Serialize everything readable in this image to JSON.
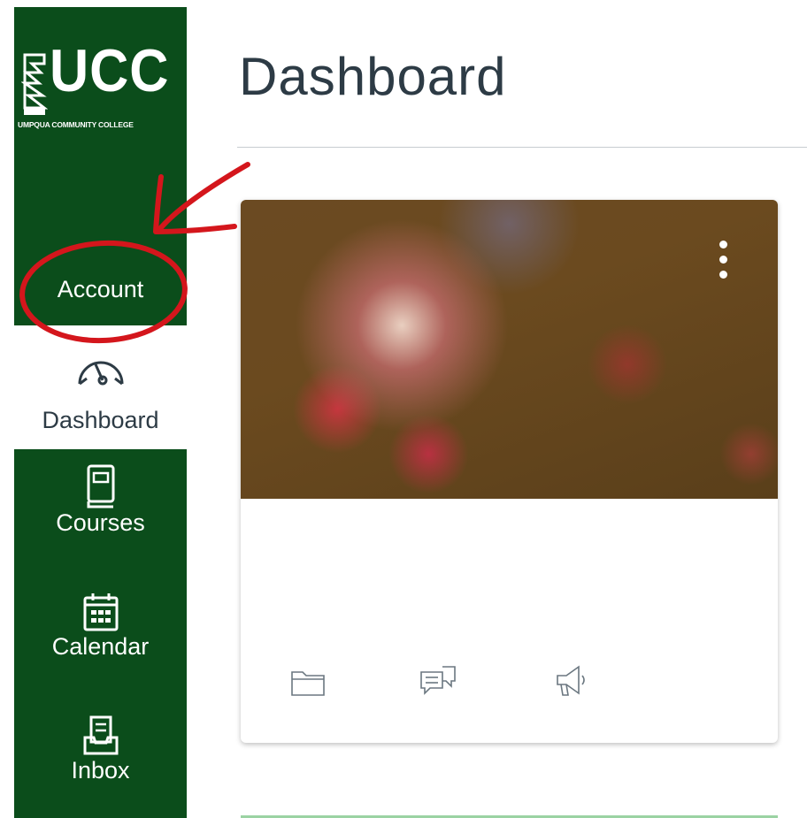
{
  "sidebar": {
    "logo": {
      "text": "UCC",
      "subtitle": "UMPQUA COMMUNITY COLLEGE"
    },
    "items": [
      {
        "label": "Account",
        "icon": "account-avatar-icon"
      },
      {
        "label": "Dashboard",
        "icon": "dashboard-gauge-icon",
        "active": true
      },
      {
        "label": "Courses",
        "icon": "book-icon"
      },
      {
        "label": "Calendar",
        "icon": "calendar-icon"
      },
      {
        "label": "Inbox",
        "icon": "inbox-icon"
      }
    ]
  },
  "main": {
    "title": "Dashboard",
    "card": {
      "menu_icon": "more-vertical-icon",
      "actions": [
        {
          "icon": "folder-icon"
        },
        {
          "icon": "discussions-icon"
        },
        {
          "icon": "announcements-megaphone-icon"
        }
      ]
    }
  },
  "colors": {
    "sidebar_bg": "#0b4d1b",
    "title_text": "#2d3b45",
    "annotation_red": "#d4161c"
  }
}
